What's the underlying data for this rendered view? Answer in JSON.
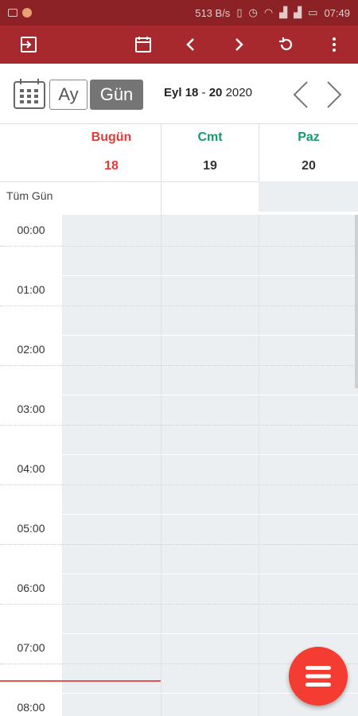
{
  "status_bar": {
    "network_speed": "513 B/s",
    "time": "07:49"
  },
  "toolbar": {
    "icons": [
      "exit-icon",
      "calendar-icon",
      "chevron-left-icon",
      "chevron-right-icon",
      "refresh-icon",
      "more-vert-icon"
    ]
  },
  "view_switch": {
    "month_label": "Ay",
    "day_label": "Gün",
    "selected": "Gün"
  },
  "date_range": {
    "month": "Eyl",
    "start_day": "18",
    "separator": " - ",
    "end_day": "20",
    "year": "2020"
  },
  "days": [
    {
      "name": "Bugün",
      "number": "18",
      "color": "#e53935"
    },
    {
      "name": "Cmt",
      "number": "19",
      "color": "#129c6b"
    },
    {
      "name": "Paz",
      "number": "20",
      "color": "#129c6b"
    }
  ],
  "all_day_label": "Tüm Gün",
  "hours": [
    "00:00",
    "01:00",
    "02:00",
    "03:00",
    "04:00",
    "05:00",
    "06:00",
    "07:00",
    "08:00"
  ],
  "colors": {
    "status_bar": "#8c2225",
    "toolbar": "#a7292d",
    "today": "#e53935",
    "weekend": "#129c6b",
    "fab": "#f43c32",
    "now_line": "#e35555"
  }
}
